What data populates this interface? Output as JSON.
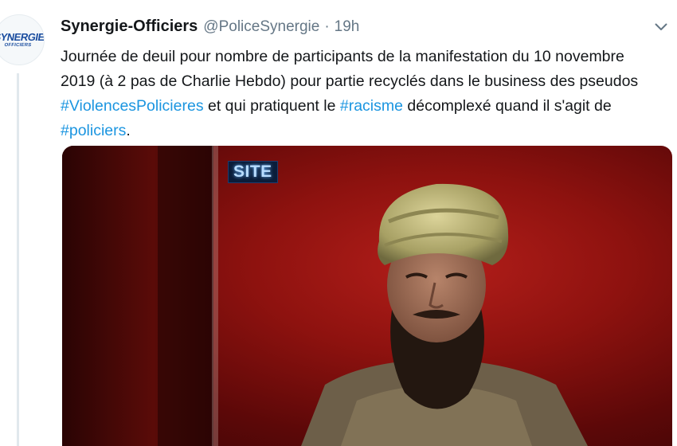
{
  "tweet": {
    "avatar_logo_line1": "SYNERGIE",
    "avatar_logo_line2": "OFFICIERS",
    "display_name": "Synergie-Officiers",
    "handle": "@PoliceSynergie",
    "separator": "·",
    "time": "19h",
    "text_parts": {
      "p1": "Journée de deuil pour nombre de participants de la manifestation du 10 novembre 2019 (à 2 pas de Charlie Hebdo) pour partie recyclés dans le business des pseudos ",
      "hashtag1": "#ViolencesPolicieres",
      "p2": " et qui pratiquent le ",
      "hashtag2": "#racisme",
      "p3": " décomplexé quand il s'agit de ",
      "hashtag3": "#policiers",
      "p4": "."
    },
    "media": {
      "badge": "SITE"
    }
  },
  "colors": {
    "text": "#14171a",
    "secondary": "#657786",
    "link": "#1b95e0",
    "media_bg": "#9b1612"
  },
  "icons": {
    "menu": "chevron-down-icon"
  }
}
